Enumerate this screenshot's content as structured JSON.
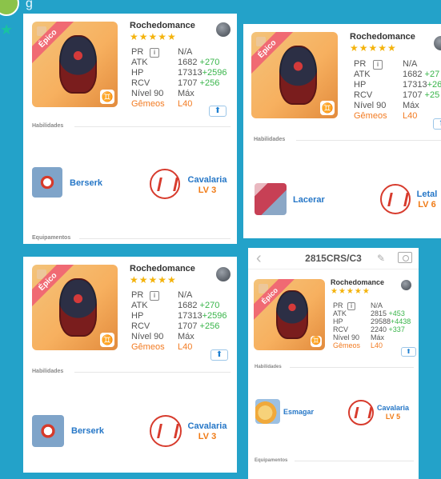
{
  "decor": {
    "top_strip_text": "g"
  },
  "cards": [
    {
      "hero_name": "Rochedomance",
      "rarity": "Épico",
      "stars": "★★★★★",
      "stats": {
        "pr_label": "PR",
        "pr_value": "N/A",
        "atk_label": "ATK",
        "atk_value": "1682",
        "atk_bonus": "+270",
        "hp_label": "HP",
        "hp_value": "17313",
        "hp_bonus": "+2596",
        "rcv_label": "RCV",
        "rcv_value": "1707",
        "rcv_bonus": "+256",
        "nivel_label": "Nível 90",
        "nivel_value": "Máx",
        "gemeos_label": "Gêmeos",
        "gemeos_value": "L40"
      },
      "section_habilidades": "Habilidades",
      "skill_name": "Berserk",
      "class_name": "Cavalaria",
      "class_level": "LV 3",
      "section_equipamentos": "Equipamentos"
    },
    {
      "hero_name": "Rochedomance",
      "rarity": "Épico",
      "stars": "★★★★★",
      "stats": {
        "pr_label": "PR",
        "pr_value": "N/A",
        "atk_label": "ATK",
        "atk_value": "1682",
        "atk_bonus": "+27",
        "hp_label": "HP",
        "hp_value": "17313",
        "hp_bonus": "+26",
        "rcv_label": "RCV",
        "rcv_value": "1707",
        "rcv_bonus": "+25",
        "nivel_label": "Nível 90",
        "nivel_value": "Máx",
        "gemeos_label": "Gêmeos",
        "gemeos_value": "L40"
      },
      "section_habilidades": "Habilidades",
      "skill_name": "Lacerar",
      "class_name": "Letal",
      "class_level": "LV 6"
    },
    {
      "hero_name": "Rochedomance",
      "rarity": "Épico",
      "stars": "★★★★★",
      "stats": {
        "pr_label": "PR",
        "pr_value": "N/A",
        "atk_label": "ATK",
        "atk_value": "1682",
        "atk_bonus": "+270",
        "hp_label": "HP",
        "hp_value": "17313",
        "hp_bonus": "+2596",
        "rcv_label": "RCV",
        "rcv_value": "1707",
        "rcv_bonus": "+256",
        "nivel_label": "Nível 90",
        "nivel_value": "Máx",
        "gemeos_label": "Gêmeos",
        "gemeos_value": "L40"
      },
      "section_habilidades": "Habilidades",
      "skill_name": "Berserk",
      "class_name": "Cavalaria",
      "class_level": "LV 3"
    },
    {
      "page_title": "2815CRS/C3",
      "hero_name": "Rochedomance",
      "rarity": "Épico",
      "stars": "★★★★★",
      "stats": {
        "pr_label": "PR",
        "pr_value": "N/A",
        "atk_label": "ATK",
        "atk_value": "2815",
        "atk_bonus": "+453",
        "hp_label": "HP",
        "hp_value": "29588",
        "hp_bonus": "+4438",
        "rcv_label": "RCV",
        "rcv_value": "2240",
        "rcv_bonus": "+337",
        "nivel_label": "Nível 90",
        "nivel_value": "Máx",
        "gemeos_label": "Gêmeos",
        "gemeos_value": "L40"
      },
      "section_habilidades": "Habilidades",
      "skill_name": "Esmagar",
      "class_name": "Cavalaria",
      "class_level": "LV 5",
      "section_equipamentos": "Equipamentos"
    }
  ]
}
